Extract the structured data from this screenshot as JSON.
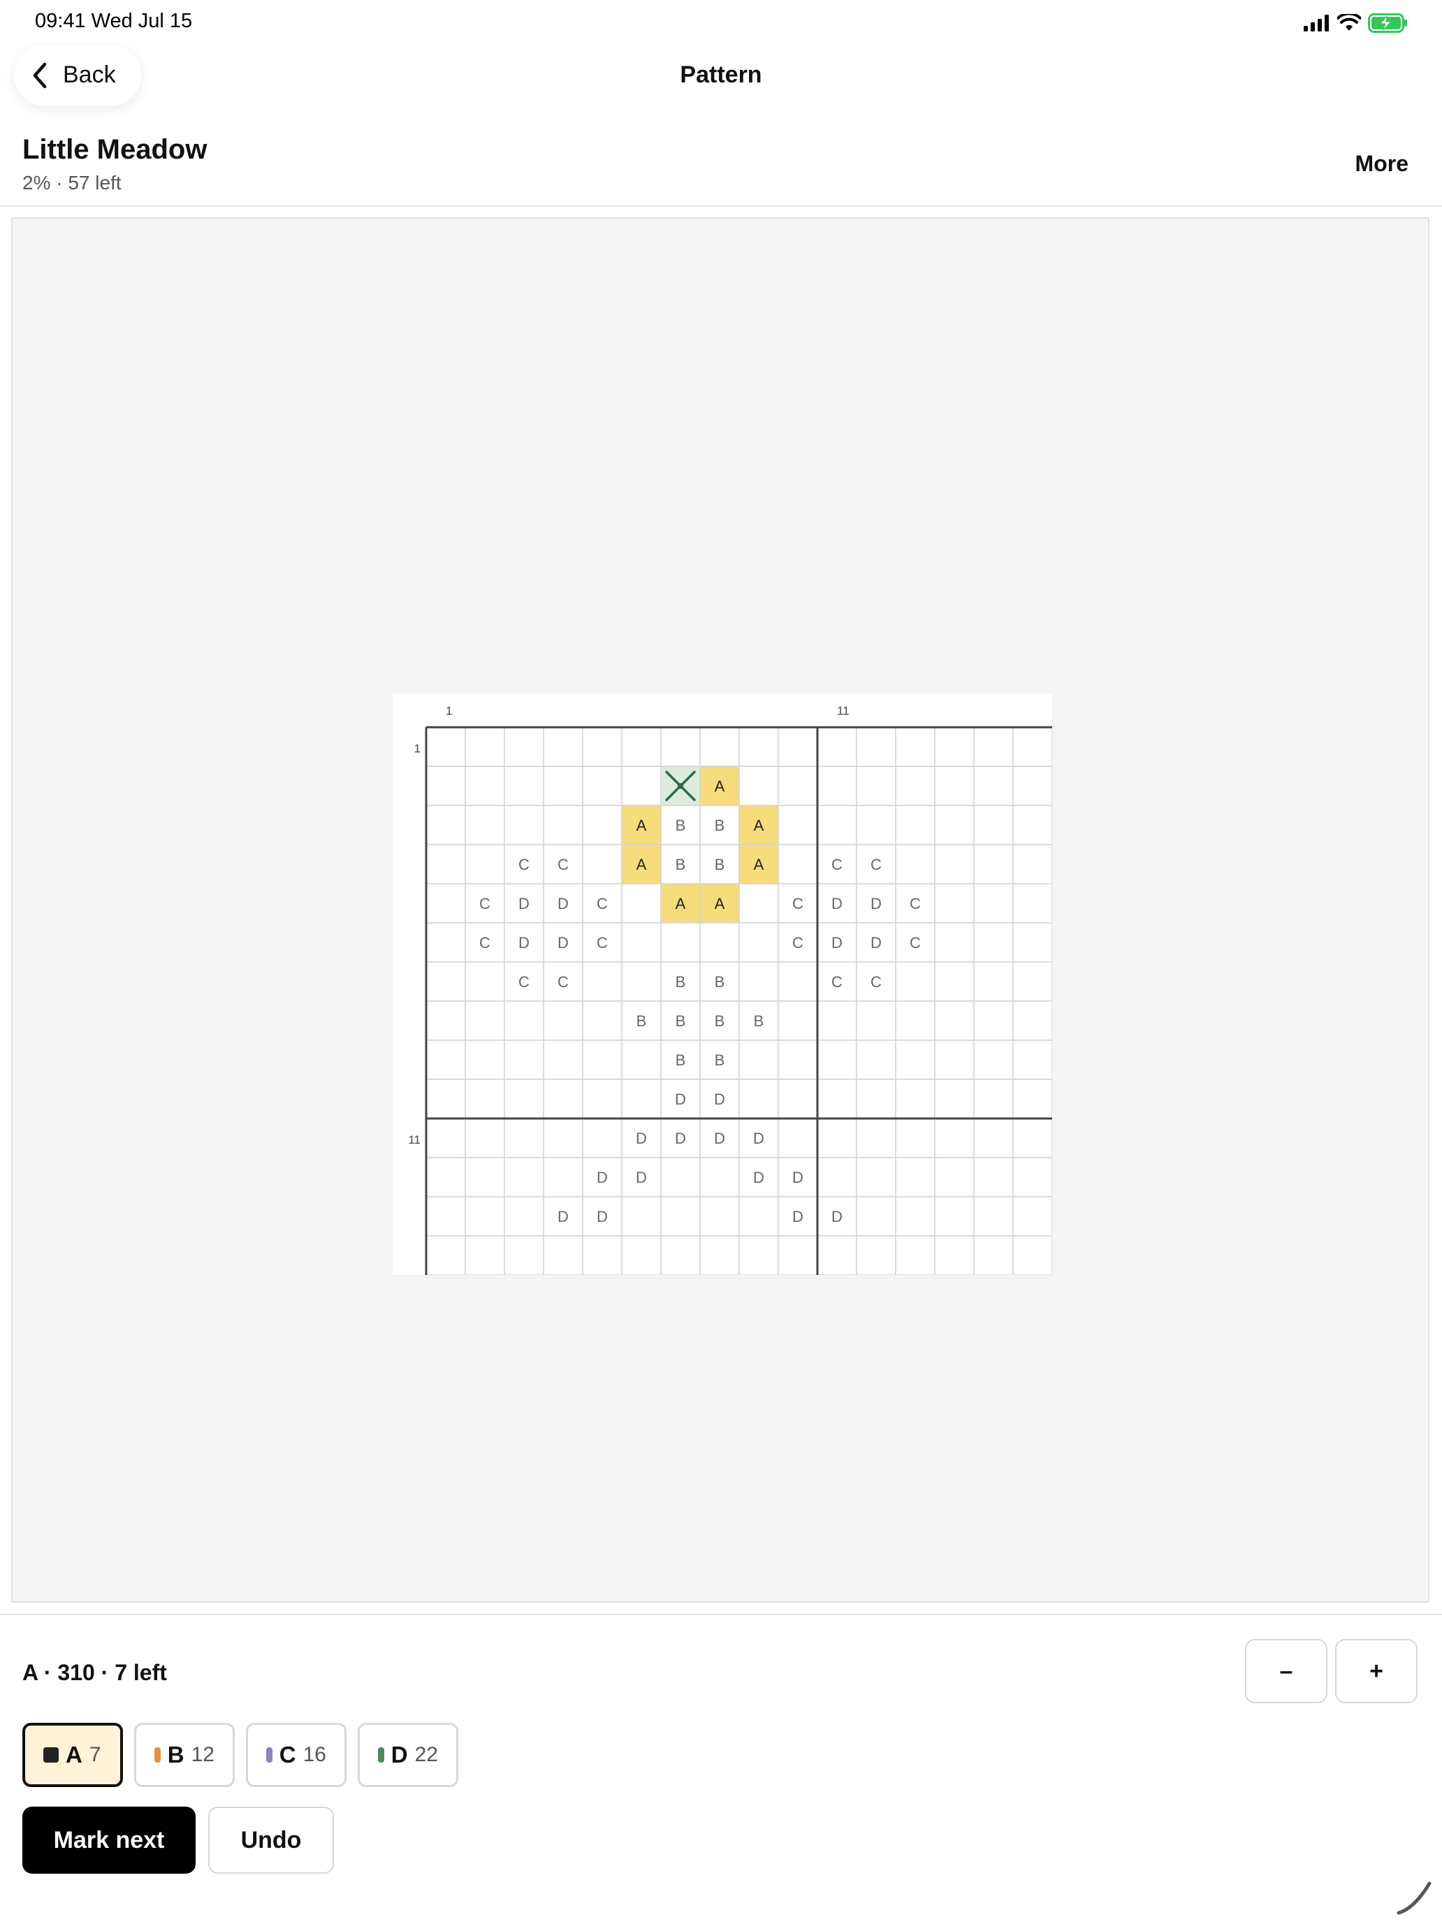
{
  "status_bar": {
    "time_date": "09:41  Wed Jul 15",
    "icons": [
      "cellular-signal-icon",
      "wifi-icon",
      "battery-charging-icon"
    ],
    "battery_color": "#34c759"
  },
  "nav": {
    "back_label": "Back",
    "title": "Pattern"
  },
  "pattern": {
    "name": "Little Meadow",
    "progress": "2% · 57 left",
    "more_label": "More"
  },
  "grid": {
    "columns": 16,
    "rows": 14,
    "column_numbers": [
      "1",
      "11"
    ],
    "row_numbers": [
      "1",
      "11"
    ],
    "highlight_symbol": "A",
    "highlight_color": "#f6dc7a",
    "done_color": "#dcebdf",
    "done_mark_color": "#2e6b45",
    "cells": [
      [
        "",
        "",
        "",
        "",
        "",
        "",
        "",
        "",
        "",
        "",
        "",
        "",
        "",
        "",
        "",
        ""
      ],
      [
        "",
        "",
        "",
        "",
        "",
        "",
        "x",
        "A",
        "",
        "",
        "",
        "",
        "",
        "",
        "",
        ""
      ],
      [
        "",
        "",
        "",
        "",
        "",
        "A",
        "B",
        "B",
        "A",
        "",
        "",
        "",
        "",
        "",
        "",
        ""
      ],
      [
        "",
        "",
        "C",
        "C",
        "",
        "A",
        "B",
        "B",
        "A",
        "",
        "C",
        "C",
        "",
        "",
        "",
        ""
      ],
      [
        "",
        "C",
        "D",
        "D",
        "C",
        "",
        "A",
        "A",
        "",
        "C",
        "D",
        "D",
        "C",
        "",
        "",
        ""
      ],
      [
        "",
        "C",
        "D",
        "D",
        "C",
        "",
        "",
        "",
        "",
        "C",
        "D",
        "D",
        "C",
        "",
        "",
        ""
      ],
      [
        "",
        "",
        "C",
        "C",
        "",
        "",
        "B",
        "B",
        "",
        "",
        "C",
        "C",
        "",
        "",
        "",
        ""
      ],
      [
        "",
        "",
        "",
        "",
        "",
        "B",
        "B",
        "B",
        "B",
        "",
        "",
        "",
        "",
        "",
        "",
        ""
      ],
      [
        "",
        "",
        "",
        "",
        "",
        "",
        "B",
        "B",
        "",
        "",
        "",
        "",
        "",
        "",
        "",
        ""
      ],
      [
        "",
        "",
        "",
        "",
        "",
        "",
        "D",
        "D",
        "",
        "",
        "",
        "",
        "",
        "",
        "",
        ""
      ],
      [
        "",
        "",
        "",
        "",
        "",
        "D",
        "D",
        "D",
        "D",
        "",
        "",
        "",
        "",
        "",
        "",
        ""
      ],
      [
        "",
        "",
        "",
        "",
        "D",
        "D",
        "",
        "",
        "D",
        "D",
        "",
        "",
        "",
        "",
        "",
        ""
      ],
      [
        "",
        "",
        "",
        "D",
        "D",
        "",
        "",
        "",
        "",
        "D",
        "D",
        "",
        "",
        "",
        "",
        ""
      ],
      [
        "",
        "",
        "",
        "",
        "",
        "",
        "",
        "",
        "",
        "",
        "",
        "",
        "",
        "",
        "",
        ""
      ]
    ]
  },
  "selection": {
    "info": "A · 310 · 7 left"
  },
  "zoom": {
    "out_label": "–",
    "in_label": "+"
  },
  "threads": [
    {
      "code": "A",
      "count": "7",
      "color": "#222222",
      "active": true
    },
    {
      "code": "B",
      "count": "12",
      "color": "#e8903a",
      "active": false
    },
    {
      "code": "C",
      "count": "16",
      "color": "#8b82bf",
      "active": false
    },
    {
      "code": "D",
      "count": "22",
      "color": "#4f8a57",
      "active": false
    }
  ],
  "actions": {
    "mark_next_label": "Mark next",
    "undo_label": "Undo"
  }
}
